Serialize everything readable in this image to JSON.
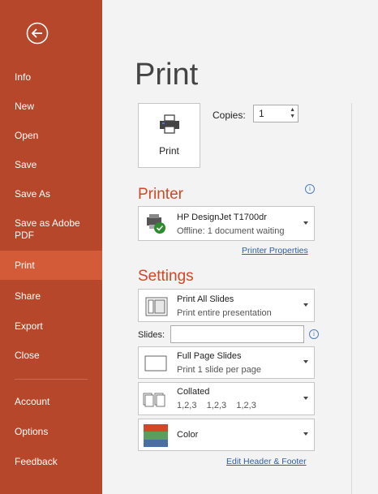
{
  "sidebar": {
    "items": [
      {
        "label": "Info"
      },
      {
        "label": "New"
      },
      {
        "label": "Open"
      },
      {
        "label": "Save"
      },
      {
        "label": "Save As"
      },
      {
        "label": "Save as Adobe PDF"
      },
      {
        "label": "Print",
        "selected": true
      },
      {
        "label": "Share"
      },
      {
        "label": "Export"
      },
      {
        "label": "Close"
      },
      {
        "label": "Account"
      },
      {
        "label": "Options"
      },
      {
        "label": "Feedback"
      }
    ],
    "back_icon": "back-arrow-icon"
  },
  "main": {
    "title": "Print",
    "print_button_label": "Print",
    "copies_label": "Copies:",
    "copies_value": "1",
    "printer_heading": "Printer",
    "printer": {
      "name": "HP DesignJet T1700dr",
      "status": "Offline: 1 document waiting"
    },
    "printer_properties_link": "Printer Properties",
    "settings_heading": "Settings",
    "print_range": {
      "title": "Print All Slides",
      "subtitle": "Print entire presentation"
    },
    "slides_label": "Slides:",
    "slides_value": "",
    "layout": {
      "title": "Full Page Slides",
      "subtitle": "Print 1 slide per page"
    },
    "collation": {
      "title": "Collated",
      "subtitle": "1,2,3    1,2,3    1,2,3"
    },
    "color": {
      "title": "Color"
    },
    "edit_header_footer_link": "Edit Header & Footer",
    "info_glyph": "i"
  },
  "colors": {
    "sidebar_bg": "#b7472a",
    "sidebar_selected": "#d35b37",
    "accent": "#d24726",
    "link": "#2e5e9e"
  }
}
